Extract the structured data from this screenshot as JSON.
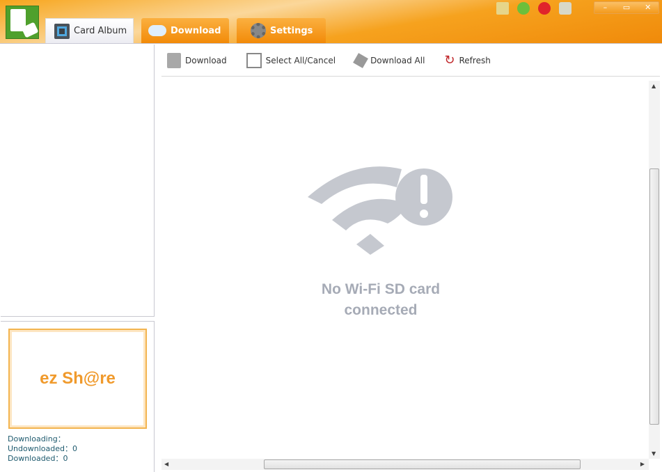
{
  "tabs": [
    {
      "label": "Card Album",
      "icon": "card-album-icon"
    },
    {
      "label": "Download",
      "icon": "cloud-icon"
    },
    {
      "label": "Settings",
      "icon": "gear-icon"
    }
  ],
  "toolbar": {
    "download": "Download",
    "select_all": "Select All/Cancel",
    "download_all": "Download All",
    "refresh": "Refresh"
  },
  "brand": {
    "logo_text": "ez Sh@re"
  },
  "stats": {
    "downloading_label": "Downloading：",
    "downloading_value": "",
    "undownloaded_label": "Undownloaded：",
    "undownloaded_value": "0",
    "downloaded_label": "Downloaded：",
    "downloaded_value": "0"
  },
  "main": {
    "message_line1": "No Wi-Fi SD card",
    "message_line2": "connected"
  },
  "colors": {
    "accent": "#f39a1c",
    "message": "#a6abb6",
    "stats_text": "#1e5a6e"
  }
}
